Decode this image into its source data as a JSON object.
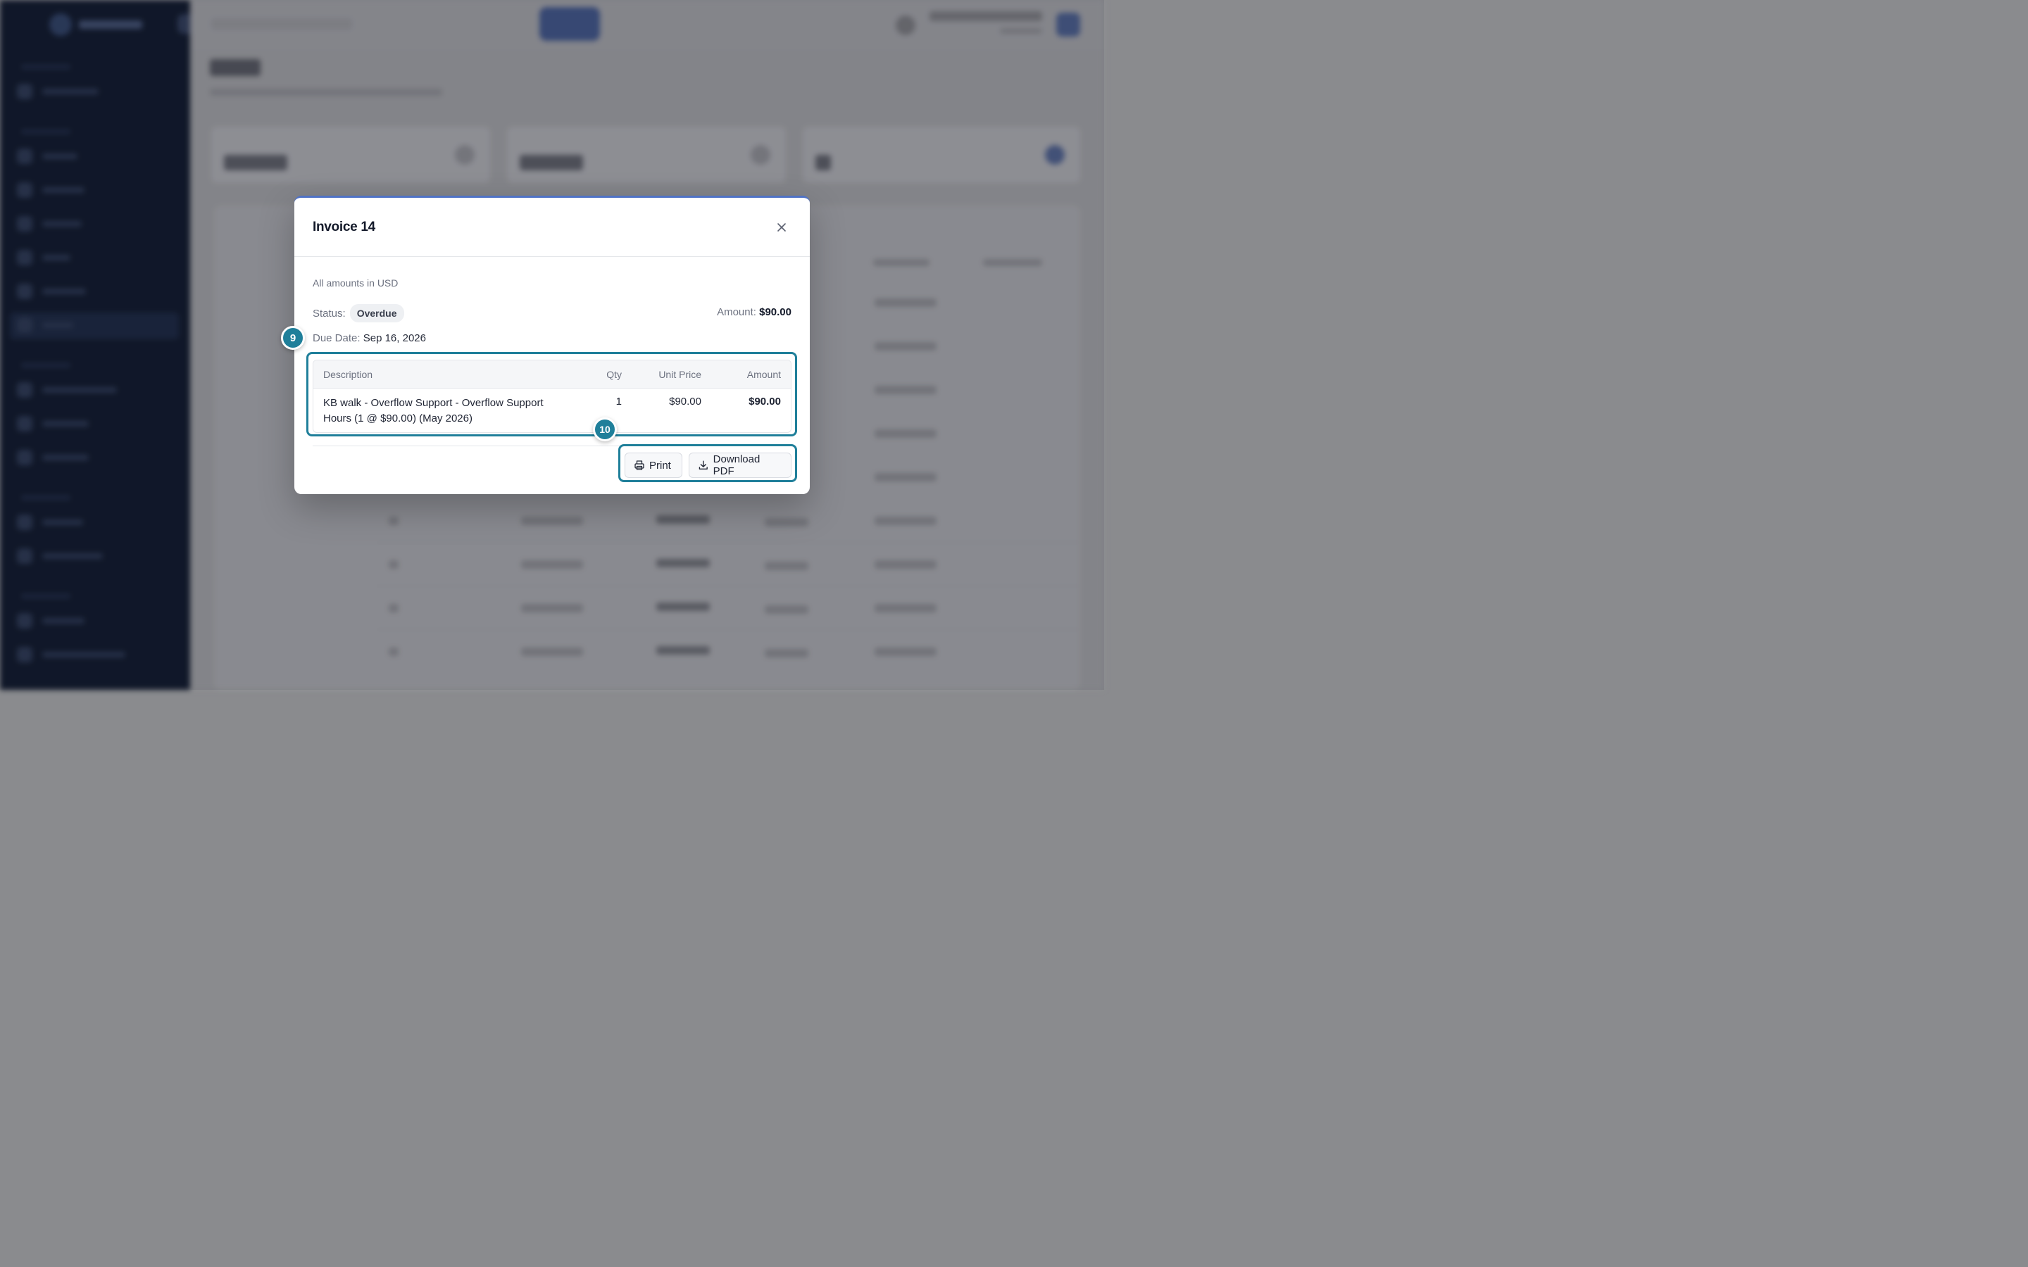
{
  "modal": {
    "title": "Invoice 14",
    "currency_note": "All amounts in USD",
    "status_label": "Status:",
    "status_value": "Overdue",
    "amount_label": "Amount:",
    "amount_value": "$90.00",
    "due_label": "Due Date:",
    "due_value": "Sep 16, 2026",
    "table": {
      "headers": [
        "Description",
        "Qty",
        "Unit Price",
        "Amount"
      ],
      "rows": [
        {
          "description": "KB walk - Overflow Support - Overflow Support Hours (1 @ $90.00) (May 2026)",
          "qty": "1",
          "unit_price": "$90.00",
          "amount": "$90.00"
        }
      ]
    },
    "actions": {
      "print_label": "Print",
      "download_label": "Download PDF"
    }
  },
  "callouts": {
    "first": "9",
    "second": "10"
  },
  "icons": {
    "close": "close-icon",
    "print": "printer-icon",
    "download": "download-icon"
  },
  "colors": {
    "accent": "#4f72c6",
    "callout": "#1f7f9a",
    "sidebar": "#0e1627"
  }
}
